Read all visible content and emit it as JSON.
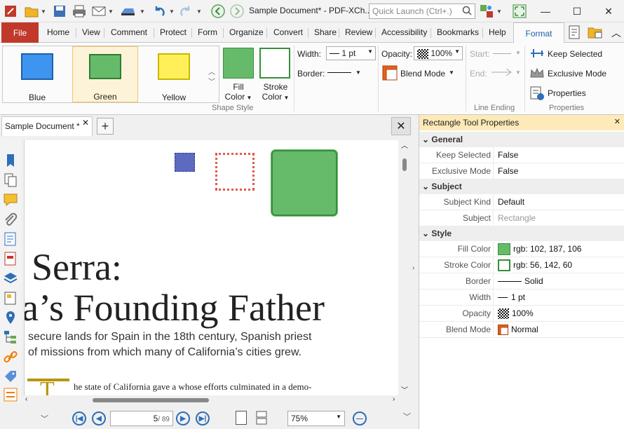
{
  "titlebar": {
    "title": "Sample Document* - PDF-XCh..",
    "quick_launch_placeholder": "Quick Launch (Ctrl+.)"
  },
  "menu": {
    "file": "File",
    "items": [
      "Home",
      "View",
      "Comment",
      "Protect",
      "Form",
      "Organize",
      "Convert",
      "Share",
      "Review",
      "Accessibility",
      "Bookmarks",
      "Help"
    ],
    "active_tab": "Format"
  },
  "ribbon": {
    "swatches": [
      {
        "label": "Blue",
        "fill": "#3d95f0",
        "stroke": "#1f5fa8"
      },
      {
        "label": "Green",
        "fill": "#66bb6a",
        "stroke": "#2e7d32"
      },
      {
        "label": "Yellow",
        "fill": "#fff05a",
        "stroke": "#c9b700"
      }
    ],
    "fill_color_label": [
      "Fill",
      "Color"
    ],
    "stroke_color_label": [
      "Stroke",
      "Color"
    ],
    "shape_style_group": "Shape Style",
    "width_label": "Width:",
    "width_value": "1 pt",
    "border_label": "Border:",
    "opacity_label": "Opacity:",
    "opacity_value": "100%",
    "blend_mode_label": "Blend Mode",
    "start_label": "Start:",
    "end_label": "End:",
    "line_ending_group": "Line Ending",
    "keep_selected": "Keep Selected",
    "exclusive_mode": "Exclusive Mode",
    "properties": "Properties",
    "properties_group": "Properties"
  },
  "document": {
    "tab_label": "Sample Document *",
    "heading_line1": "Serra:",
    "heading_line2": "a’s Founding Father",
    "sub_line1": "secure lands for Spain in the 18th century, Spanish priest",
    "sub_line2": "of missions from which many of California’s cities grew.",
    "body_drop_cap": "T",
    "body_text": "he state of California gave a    whose efforts culminated in a demo-",
    "page_current": "5",
    "page_total": "/ 89",
    "zoom": "75%"
  },
  "panel": {
    "title": "Rectangle Tool Properties",
    "sections": {
      "general": "General",
      "subject": "Subject",
      "style": "Style"
    },
    "rows": {
      "keep_selected": {
        "key": "Keep Selected",
        "value": "False"
      },
      "exclusive_mode": {
        "key": "Exclusive Mode",
        "value": "False"
      },
      "subject_kind": {
        "key": "Subject Kind",
        "value": "Default"
      },
      "subject": {
        "key": "Subject",
        "value": "Rectangle"
      },
      "fill_color": {
        "key": "Fill Color",
        "value": "rgb: 102, 187, 106"
      },
      "stroke_color": {
        "key": "Stroke Color",
        "value": "rgb: 56, 142, 60"
      },
      "border": {
        "key": "Border",
        "value": "Solid"
      },
      "width": {
        "key": "Width",
        "value": "1 pt"
      },
      "opacity": {
        "key": "Opacity",
        "value": "100%"
      },
      "blend_mode": {
        "key": "Blend Mode",
        "value": "Normal"
      }
    }
  },
  "colors": {
    "accent": "#1f5fa8",
    "file_tab": "#c0392b",
    "panel_header": "#fdeab8",
    "fill_green": "#66bb6a",
    "stroke_green": "#388e3c"
  }
}
